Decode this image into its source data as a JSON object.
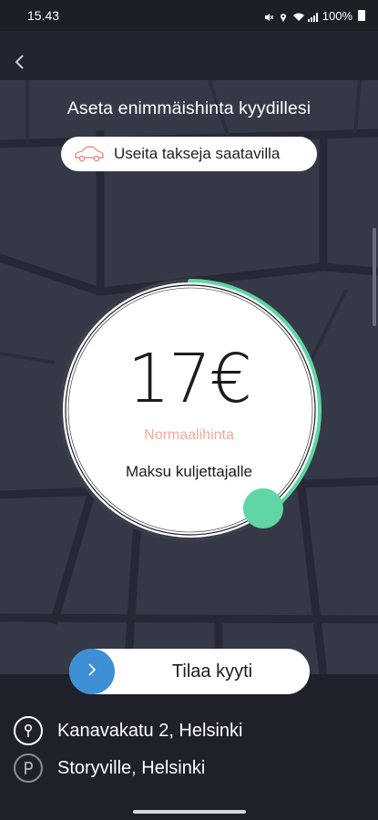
{
  "status_bar": {
    "time": "15.43",
    "battery": "100%"
  },
  "header": {
    "back_icon": "chevron-left-icon"
  },
  "main": {
    "title": "Aseta enimmäishinta kyydillesi",
    "taxi_badge": {
      "icon": "car-icon",
      "label": "Useita takseja saatavilla"
    },
    "price": {
      "value": "17€",
      "tier_label": "Normaalihinta",
      "note": "Maksu kuljettajalle",
      "dial_level": 0.4,
      "accent_color": "#5fd6a4"
    }
  },
  "order_button": {
    "label": "Tilaa kyyti",
    "icon": "chevron-right-icon",
    "icon_color": "#3d8fd6"
  },
  "route": {
    "pickup": {
      "icon": "location-pin-icon",
      "address": "Kanavakatu 2, Helsinki"
    },
    "destination": {
      "icon": "parking-icon",
      "address": "Storyville, Helsinki"
    }
  }
}
